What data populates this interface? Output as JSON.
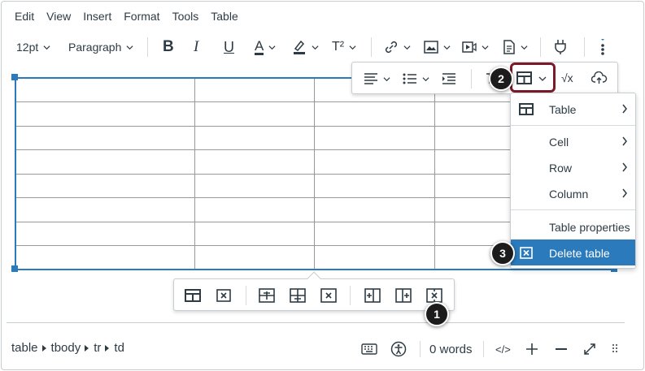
{
  "menubar": {
    "items": [
      "Edit",
      "View",
      "Insert",
      "Format",
      "Tools",
      "Table"
    ]
  },
  "toolbar": {
    "font_size": "12pt",
    "block_format": "Paragraph",
    "icons": [
      "bold-icon",
      "italic-icon",
      "underline-icon",
      "text-color-icon",
      "highlight-icon",
      "superscript-icon",
      "link-icon",
      "image-icon",
      "media-icon",
      "document-icon",
      "plugin-icon",
      "more-icon"
    ],
    "bold": "B",
    "italic": "I",
    "underline": "U",
    "text_color": "A",
    "superscript": "T²"
  },
  "table_toolbar": {
    "icons": [
      "align-icon",
      "list-icon",
      "indent-icon",
      "table-icon",
      "math-icon",
      "cloud-icon"
    ],
    "math": "√x"
  },
  "dropdown": {
    "items": [
      {
        "label": "Table",
        "submenu": true
      },
      {
        "label": "Cell",
        "submenu": true
      },
      {
        "label": "Row",
        "submenu": true
      },
      {
        "label": "Column",
        "submenu": true
      },
      {
        "label": "Table properties",
        "submenu": false
      },
      {
        "label": "Delete table",
        "submenu": false,
        "active": true
      }
    ]
  },
  "callouts": [
    "1",
    "2",
    "3"
  ],
  "status": {
    "path": [
      "table",
      "tbody",
      "tr",
      "td"
    ],
    "word_count": "0 words",
    "html_toggle": "</>"
  },
  "colors": {
    "accent": "#2b7abc",
    "callout_outline": "#7b1a2a",
    "text": "#2d3b45"
  }
}
